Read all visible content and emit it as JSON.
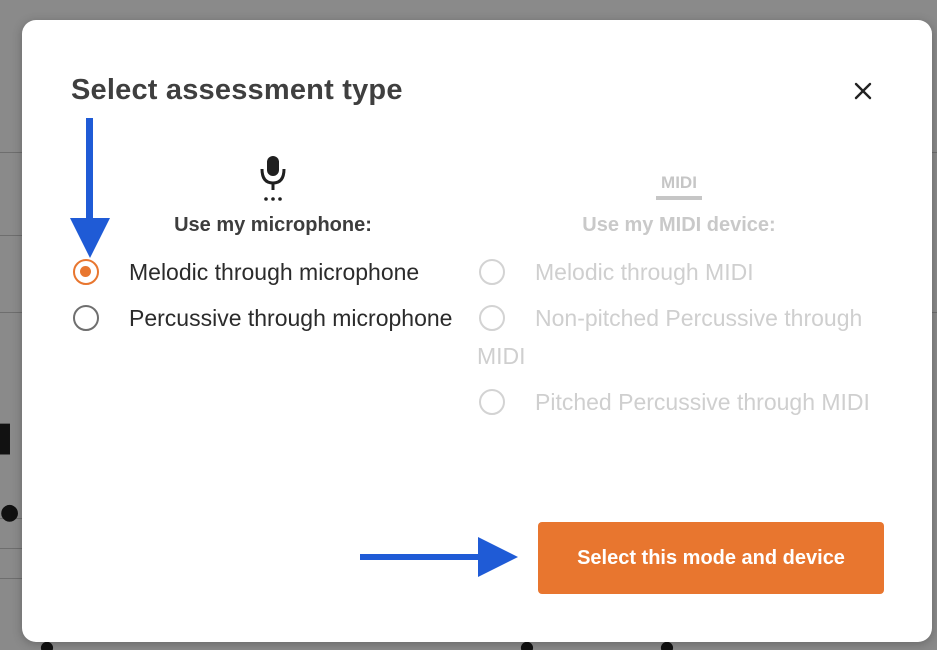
{
  "dialog": {
    "title": "Select assessment type",
    "close_icon": "close-icon",
    "columns": {
      "microphone": {
        "icon": "microphone-icon",
        "label": "Use my microphone:",
        "options": [
          {
            "label": "Melodic through microphone",
            "checked": true
          },
          {
            "label": "Percussive through microphone",
            "checked": false
          }
        ]
      },
      "midi": {
        "icon": "midi-icon",
        "icon_text": "MIDI",
        "label": "Use my MIDI device:",
        "disabled": true,
        "options": [
          {
            "label": "Melodic through MIDI",
            "checked": false
          },
          {
            "label": "Non-pitched Percussive through MIDI",
            "checked": false
          },
          {
            "label": "Pitched Percussive through MIDI",
            "checked": false
          }
        ]
      }
    },
    "primary_button": "Select this mode and device"
  },
  "colors": {
    "accent": "#e8762f",
    "annotation_arrow": "#1f5bd6",
    "title_text": "#3f3f3f",
    "disabled_text": "#cfcfcf"
  },
  "annotations": [
    {
      "type": "arrow",
      "direction": "down",
      "points_to": "Melodic through microphone radio"
    },
    {
      "type": "arrow",
      "direction": "right",
      "points_to": "Select this mode and device button"
    }
  ]
}
